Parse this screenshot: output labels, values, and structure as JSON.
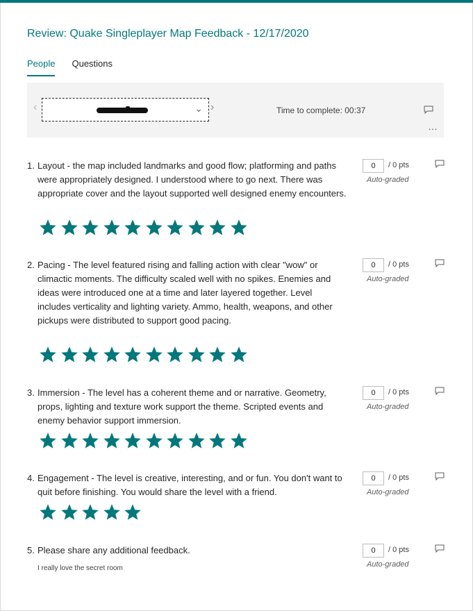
{
  "accent_color": "#03787c",
  "header": {
    "title": "Review: Quake Singleplayer Map Feedback - 12/17/2020"
  },
  "tabs": [
    {
      "label": "People",
      "active": true
    },
    {
      "label": "Questions",
      "active": false
    }
  ],
  "respondent_bar": {
    "selected_respondent": "",
    "prev_icon": "chevron-left-icon",
    "next_icon": "chevron-right-icon",
    "time_to_complete": "Time to complete: 00:37",
    "comment_icon": "comment-icon",
    "more_icon": "more-options-icon"
  },
  "questions": [
    {
      "number": "1.",
      "text": "Layout - the map included landmarks and good flow; platforming and paths were appropriately designed. I understood where to go next. There was appropriate cover and the layout supported well designed enemy encounters.",
      "points_value": "0",
      "points_total": "/ 0 pts",
      "grading": "Auto-graded",
      "rating": 10,
      "rating_max": 10
    },
    {
      "number": "2.",
      "text": "Pacing - The level featured rising and falling action with clear \"wow\" or climactic moments. The difficulty scaled well with no spikes. Enemies and ideas were introduced one at a time and later layered together. Level includes verticality and lighting variety. Ammo, health, weapons, and other pickups were distributed to support good pacing.",
      "points_value": "0",
      "points_total": "/ 0 pts",
      "grading": "Auto-graded",
      "rating": 10,
      "rating_max": 10
    },
    {
      "number": "3.",
      "text": "Immersion - The level has a coherent theme and or narrative. Geometry, props, lighting and texture work support the theme. Scripted events and enemy behavior support immersion.",
      "points_value": "0",
      "points_total": "/ 0 pts",
      "grading": "Auto-graded",
      "rating": 10,
      "rating_max": 10
    },
    {
      "number": "4.",
      "text": "Engagement - The level is creative, interesting, and or fun. You don't want to quit before finishing. You would share the level with a friend.",
      "points_value": "0",
      "points_total": "/ 0 pts",
      "grading": "Auto-graded",
      "rating": 5,
      "rating_max": 5
    },
    {
      "number": "5.",
      "text": "Please share any additional feedback.",
      "points_value": "0",
      "points_total": "/ 0 pts",
      "grading": "Auto-graded",
      "answer": "I really love the secret room"
    }
  ]
}
